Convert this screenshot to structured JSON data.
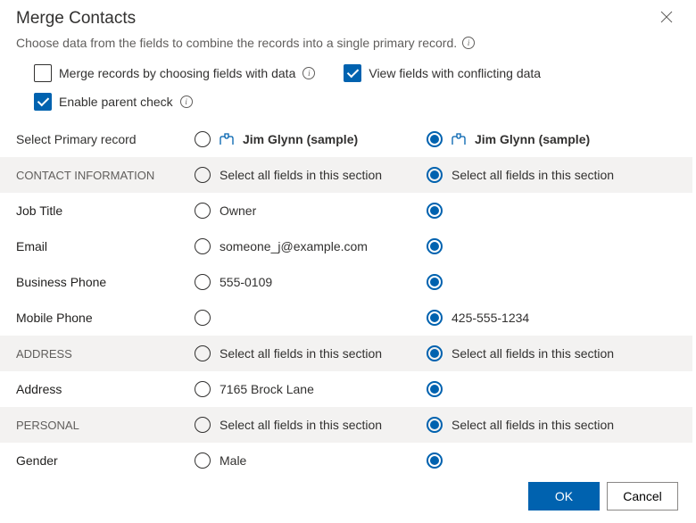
{
  "dialog": {
    "title": "Merge Contacts",
    "subtitle": "Choose data from the fields to combine the records into a single primary record."
  },
  "options": {
    "merge_by_data": {
      "label": "Merge records by choosing fields with data",
      "checked": false
    },
    "view_conflicts": {
      "label": "View fields with conflicting data",
      "checked": true
    },
    "parent_check": {
      "label": "Enable parent check",
      "checked": true
    }
  },
  "primary_row": {
    "label": "Select Primary record",
    "record1": "Jim Glynn (sample)",
    "record2": "Jim Glynn (sample)"
  },
  "sections": {
    "contact_info": {
      "header": "CONTACT INFORMATION",
      "select_all": "Select all fields in this section",
      "rows": {
        "job_title": {
          "label": "Job Title",
          "v1": "Owner",
          "v2": ""
        },
        "email": {
          "label": "Email",
          "v1": "someone_j@example.com",
          "v2": ""
        },
        "business_phone": {
          "label": "Business Phone",
          "v1": "555-0109",
          "v2": ""
        },
        "mobile_phone": {
          "label": "Mobile Phone",
          "v1": "",
          "v2": "425-555-1234"
        }
      }
    },
    "address": {
      "header": "ADDRESS",
      "select_all": "Select all fields in this section",
      "rows": {
        "address": {
          "label": "Address",
          "v1": "7165 Brock Lane",
          "v2": ""
        }
      }
    },
    "personal": {
      "header": "PERSONAL",
      "select_all": "Select all fields in this section",
      "rows": {
        "gender": {
          "label": "Gender",
          "v1": "Male",
          "v2": ""
        }
      }
    }
  },
  "footer": {
    "ok": "OK",
    "cancel": "Cancel"
  }
}
